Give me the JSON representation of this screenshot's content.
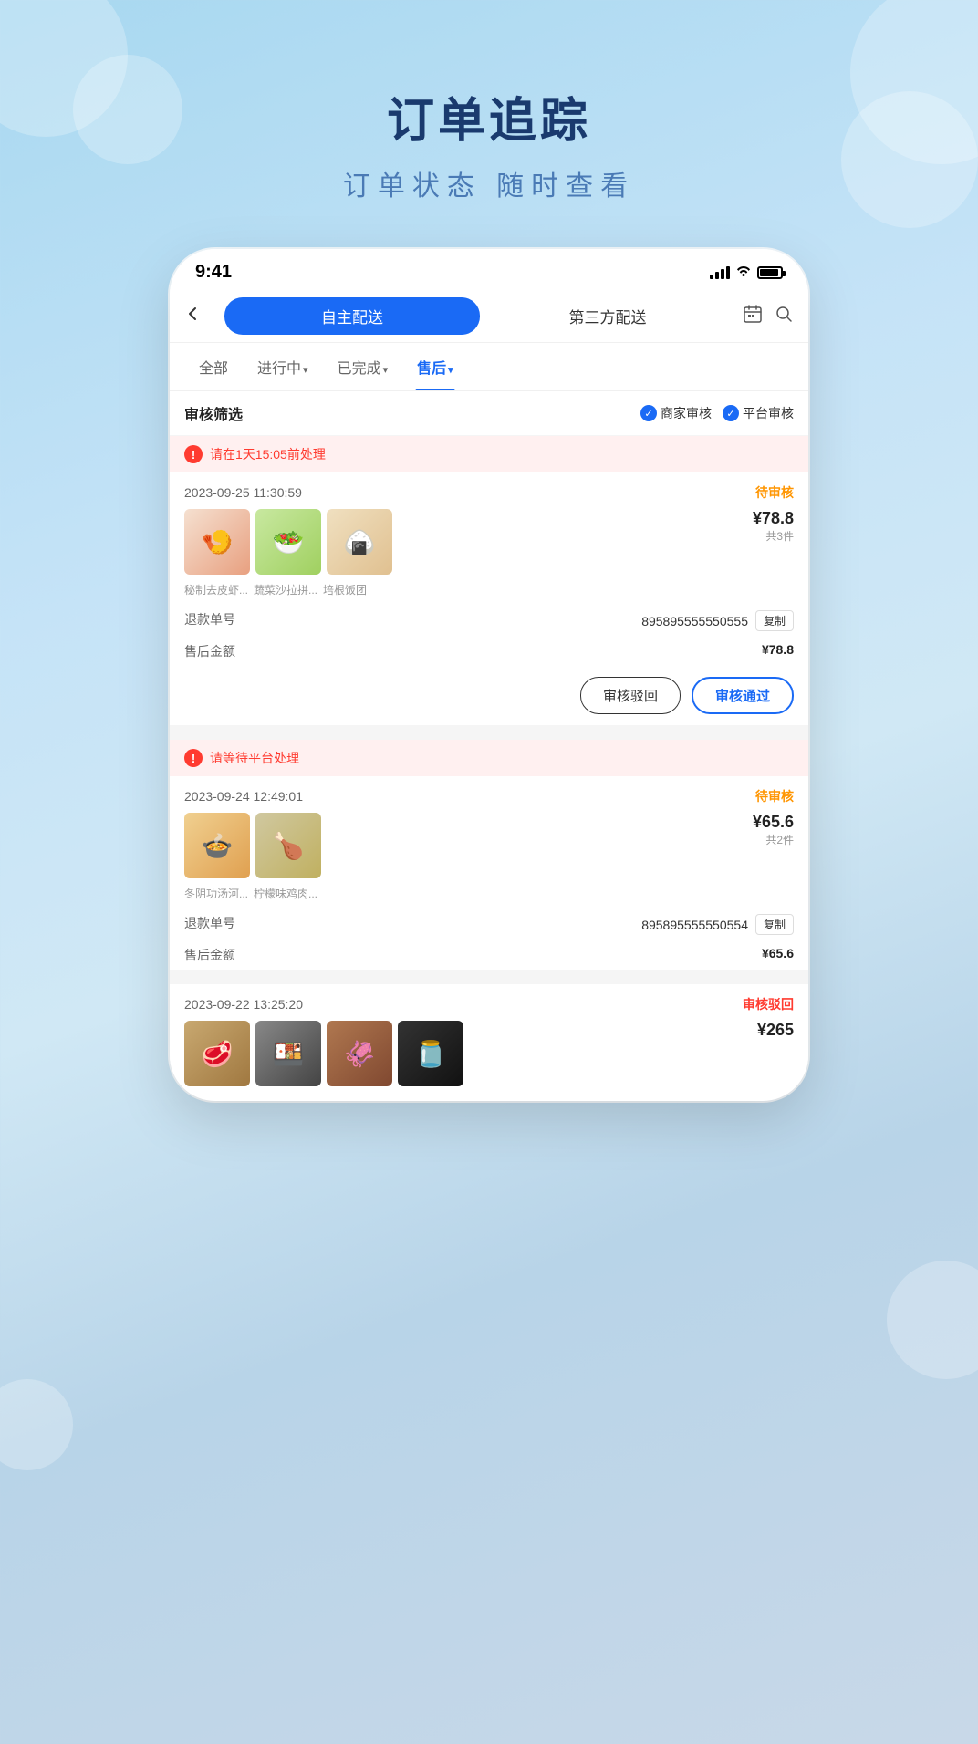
{
  "background": {
    "title": "订单追踪",
    "subtitle": "订单状态 随时查看"
  },
  "phone": {
    "statusBar": {
      "time": "9:41",
      "signal": "signal",
      "wifi": "wifi",
      "battery": "battery"
    },
    "navBar": {
      "backLabel": "<",
      "tab1": "自主配送",
      "tab2": "第三方配送",
      "calendarIcon": "📅",
      "searchIcon": "🔍"
    },
    "filterTabs": [
      {
        "label": "全部",
        "active": false
      },
      {
        "label": "进行中",
        "arrow": "▾",
        "active": false
      },
      {
        "label": "已完成",
        "arrow": "▾",
        "active": false
      },
      {
        "label": "售后",
        "arrow": "▾",
        "active": true
      }
    ],
    "auditFilter": {
      "label": "审核筛选",
      "chips": [
        {
          "label": "商家审核",
          "checked": true
        },
        {
          "label": "平台审核",
          "checked": true
        }
      ]
    },
    "orders": [
      {
        "id": "order1",
        "alert": "请在1天15:05前处理",
        "date": "2023-09-25 11:30:59",
        "status": "待审核",
        "statusType": "pending",
        "images": [
          {
            "type": "shrimp",
            "label": "秘制去皮虾..."
          },
          {
            "type": "salad",
            "label": "蔬菜沙拉拼..."
          },
          {
            "type": "sushi",
            "label": "培根饭团"
          }
        ],
        "price": "¥78.8",
        "count": "共3件",
        "refundNo": "895895555550555",
        "afterSaleAmount": "¥78.8",
        "copyLabel": "复制",
        "refundLabel": "退款单号",
        "amountLabel": "售后金额",
        "actions": {
          "reject": "审核驳回",
          "approve": "审核通过"
        }
      },
      {
        "id": "order2",
        "alert": "请等待平台处理",
        "date": "2023-09-24 12:49:01",
        "status": "待审核",
        "statusType": "pending",
        "images": [
          {
            "type": "soup",
            "label": "冬阴功汤河..."
          },
          {
            "type": "chicken",
            "label": "柠檬味鸡肉..."
          }
        ],
        "price": "¥65.6",
        "count": "共2件",
        "refundNo": "895895555550554",
        "afterSaleAmount": "¥65.6",
        "copyLabel": "复制",
        "refundLabel": "退款单号",
        "amountLabel": "售后金额"
      },
      {
        "id": "order3",
        "alert": null,
        "date": "2023-09-22 13:25:20",
        "status": "审核驳回",
        "statusType": "rejected",
        "images": [
          {
            "type": "grill1",
            "label": ""
          },
          {
            "type": "grill2",
            "label": ""
          },
          {
            "type": "grill3",
            "label": ""
          },
          {
            "type": "grill4",
            "label": ""
          }
        ],
        "price": "¥265",
        "count": ""
      }
    ]
  }
}
